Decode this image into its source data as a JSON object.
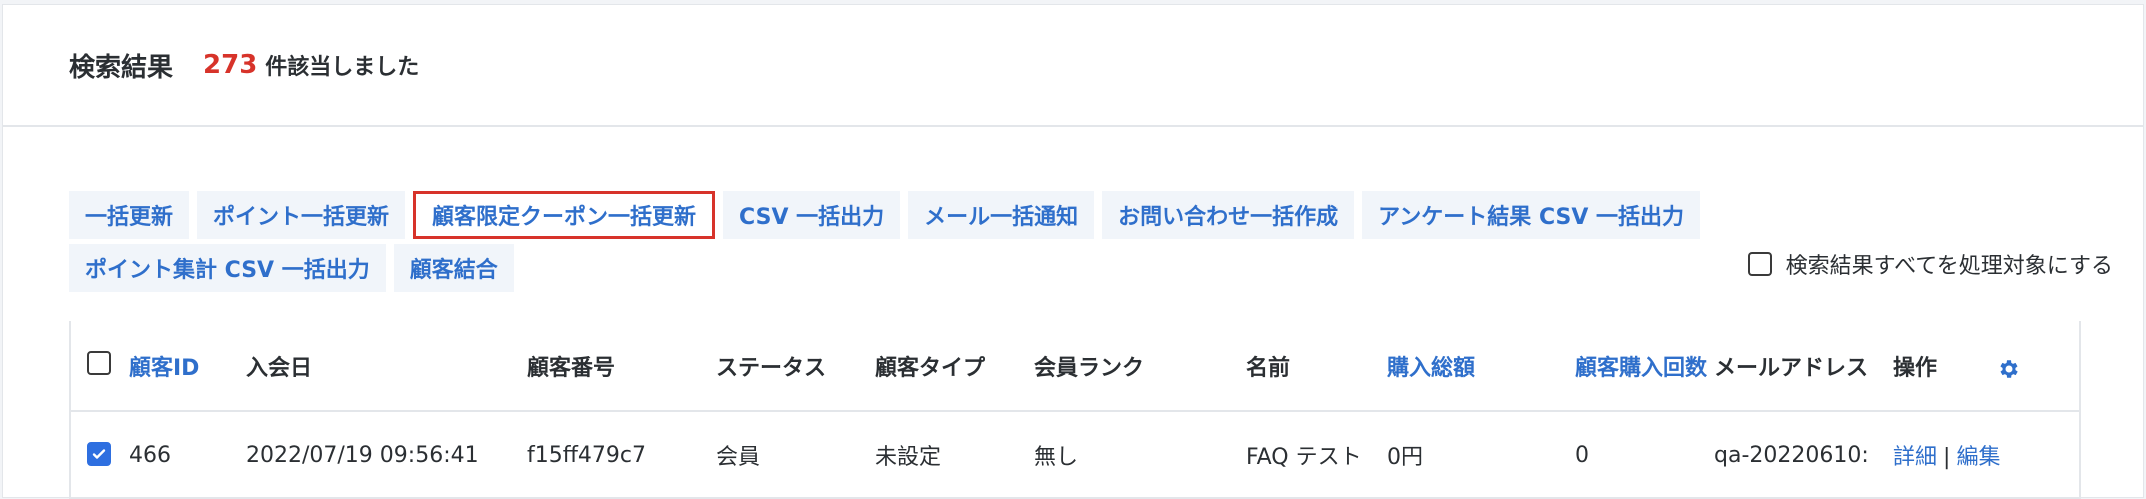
{
  "header": {
    "title": "検索結果",
    "count": "273",
    "count_suffix": "件該当しました"
  },
  "actions": {
    "row1": [
      {
        "label": "一括更新"
      },
      {
        "label": "ポイント一括更新"
      },
      {
        "label": "顧客限定クーポン一括更新",
        "highlighted": true
      },
      {
        "label": "CSV 一括出力"
      },
      {
        "label": "メール一括通知"
      },
      {
        "label": "お問い合わせ一括作成"
      },
      {
        "label": "アンケート結果 CSV 一括出力"
      }
    ],
    "row2": [
      {
        "label": "ポイント集計 CSV 一括出力"
      },
      {
        "label": "顧客結合"
      }
    ],
    "select_all_label": "検索結果すべてを処理対象にする"
  },
  "table": {
    "columns": [
      "顧客ID",
      "入会日",
      "顧客番号",
      "ステータス",
      "顧客タイプ",
      "会員ランク",
      "名前",
      "購入総額",
      "顧客購入回数",
      "メールアドレス",
      "操作"
    ],
    "settings_icon": "gear-icon",
    "rows": [
      {
        "checked": true,
        "customer_id": "466",
        "joined": "2022/07/19 09:56:41",
        "customer_no": "f15ff479c7",
        "status": "会員",
        "type": "未設定",
        "rank": "無し",
        "name": "FAQ テスト",
        "total": "0円",
        "purchase_count": "0",
        "email": "qa-20220610:",
        "detail_label": "詳細",
        "edit_label": "編集"
      }
    ]
  },
  "colors": {
    "accent": "#2f6fcb",
    "count": "#d7332a",
    "highlight_border": "#d7332a",
    "checkbox_checked": "#2e6fe0"
  }
}
